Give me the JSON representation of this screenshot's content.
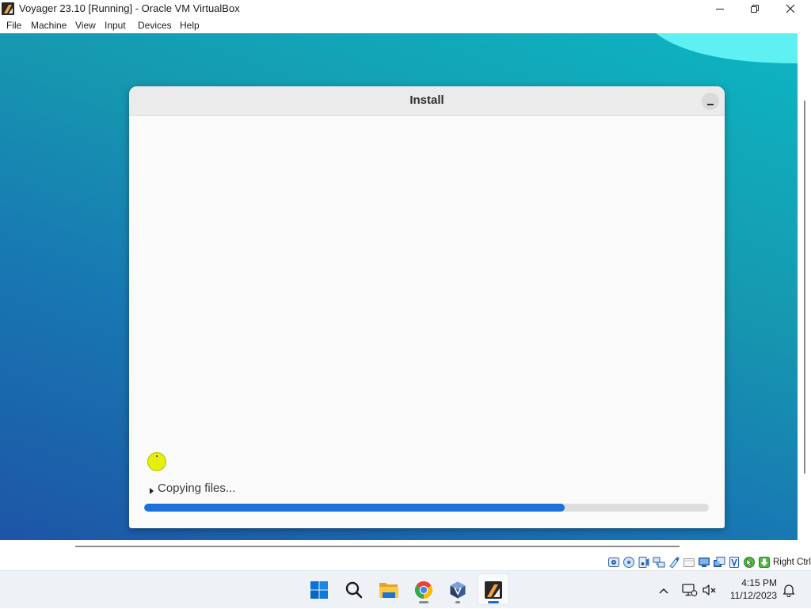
{
  "window": {
    "title": "Voyager 23.10 [Running] - Oracle VM VirtualBox",
    "app_icon": "voyager-vm-icon",
    "controls": [
      "minimize-icon",
      "restore-icon",
      "close-icon"
    ]
  },
  "menu": {
    "items": [
      "File",
      "Machine",
      "View",
      "Input",
      "Devices",
      "Help"
    ]
  },
  "guest": {
    "installer": {
      "title": "Install",
      "header_button_icon": "minimize-icon",
      "expander_icon": "expander-arrow-icon",
      "status_text": "Copying files...",
      "progress": 0.745
    }
  },
  "statusbar": {
    "icons": [
      "hard-disk-icon",
      "optical-drive-icon",
      "audio-icon",
      "network-icon",
      "usb-icon",
      "shared-folders-icon",
      "display-icon",
      "recording-icon",
      "cpu-icon",
      "mouse-integration-icon",
      "keyboard-capture-icon"
    ],
    "host_key": "Right Ctrl"
  },
  "taskbar": {
    "apps": [
      "windows-start-icon",
      "search-icon",
      "file-explorer-icon",
      "chrome-icon",
      "virtualbox-icon",
      "voyager-vm-icon"
    ],
    "active_app": "voyager-vm-icon",
    "tray_icons": [
      "chevron-up-icon",
      "network-icon",
      "volume-muted-icon",
      "notification-bell-icon"
    ],
    "clock": {
      "time": "4:15 PM",
      "date": "11/12/2023"
    }
  },
  "colors": {
    "progress_fill": "#1c71d8",
    "progress_track": "#dedede",
    "desktop_top": "#0cb6c3",
    "desktop_bottom": "#1d55a6",
    "desktop_arc": "#5ff0f4",
    "taskbar_bg": "#eef1f6"
  }
}
